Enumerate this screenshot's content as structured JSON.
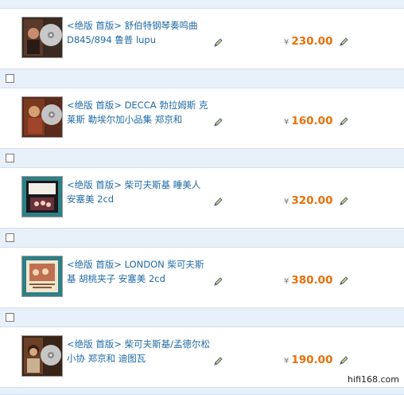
{
  "currency_symbol": "¥",
  "items": [
    {
      "title": "<绝版 首版> 舒伯特钢琴奏鸣曲D845/894 鲁普 lupu",
      "price": "230.00"
    },
    {
      "title": "<绝版 首版> DECCA 勃拉姆斯 克莱斯 勒埃尔加小品集 郑京和",
      "price": "160.00"
    },
    {
      "title": "<绝版 首版> 柴可夫斯基 睡美人 安塞美 2cd",
      "price": "320.00"
    },
    {
      "title": "<绝版 首版> LONDON 柴可夫斯基 胡桃夹子 安塞美 2cd",
      "price": "380.00"
    },
    {
      "title": "<绝版 首版> 柴可夫斯基/孟德尔松 小协 郑京和 迪图瓦",
      "price": "190.00"
    }
  ],
  "watermark": "hifi168.com",
  "colors": {
    "link": "#1f6aa5",
    "price": "#e8700a",
    "strip": "#e8f0fa"
  }
}
